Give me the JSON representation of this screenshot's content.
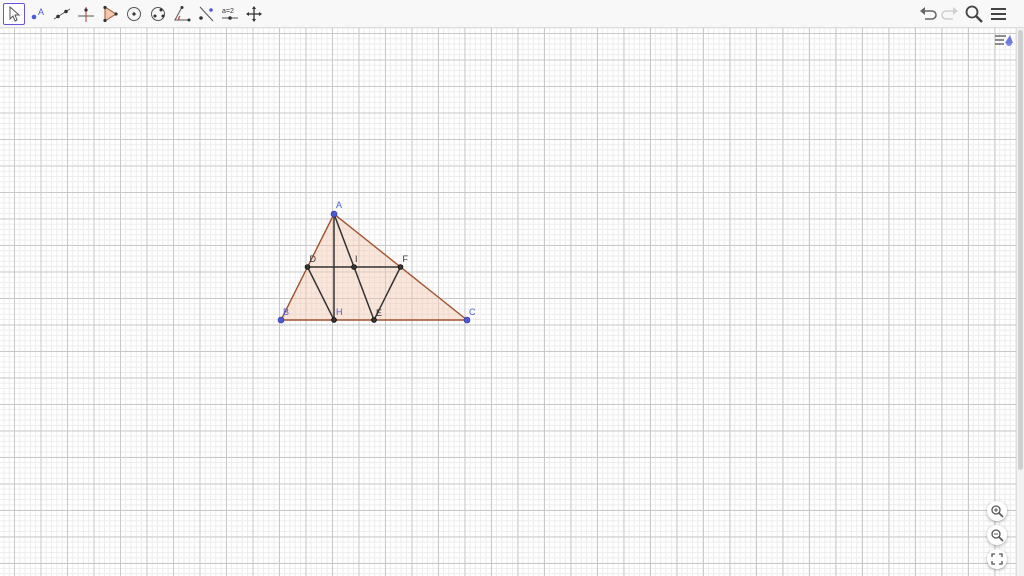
{
  "toolbar": {
    "tools": [
      {
        "id": "move",
        "icon": "move-arrow-icon",
        "active": true
      },
      {
        "id": "point",
        "icon": "point-icon",
        "label": "A"
      },
      {
        "id": "line",
        "icon": "line-icon"
      },
      {
        "id": "perpendicular",
        "icon": "perpendicular-line-icon"
      },
      {
        "id": "polygon",
        "icon": "polygon-icon"
      },
      {
        "id": "circle",
        "icon": "circle-center-point-icon"
      },
      {
        "id": "ellipse",
        "icon": "ellipse-icon"
      },
      {
        "id": "angle",
        "icon": "angle-icon"
      },
      {
        "id": "reflect",
        "icon": "reflect-about-line-icon"
      },
      {
        "id": "slider",
        "icon": "slider-icon",
        "label": "a=2"
      },
      {
        "id": "move-graphics",
        "icon": "move-graphics-view-icon"
      }
    ],
    "right": [
      "undo-icon",
      "redo-icon",
      "search-icon",
      "menu-icon"
    ]
  },
  "geometry": {
    "points": {
      "A": {
        "label": "A",
        "kind": "free"
      },
      "B": {
        "label": "B",
        "kind": "free"
      },
      "C": {
        "label": "C",
        "kind": "free"
      },
      "D": {
        "label": "D",
        "kind": "dependent"
      },
      "F": {
        "label": "F",
        "kind": "dependent"
      },
      "H": {
        "label": "H",
        "kind": "dependent"
      },
      "E": {
        "label": "E",
        "kind": "dependent"
      },
      "I": {
        "label": "I",
        "kind": "dependent"
      }
    },
    "segments": [
      [
        "A",
        "H"
      ],
      [
        "D",
        "F"
      ],
      [
        "D",
        "H"
      ],
      [
        "A",
        "E"
      ],
      [
        "F",
        "E"
      ]
    ]
  },
  "colors": {
    "accent": "#6557d2",
    "triangle_stroke": "#a0522d",
    "triangle_fill": "#f3c8b0",
    "free_point": "#4d5ad6",
    "dependent_point": "#333333",
    "segment": "#333333",
    "free_label": "#4d5ad6",
    "dependent_label": "#333333",
    "dependent_label_H": "#4d5ad6"
  },
  "side_controls": [
    "style-bar-toggle-icon",
    "zoom-in-icon",
    "zoom-out-icon",
    "fullscreen-icon"
  ]
}
